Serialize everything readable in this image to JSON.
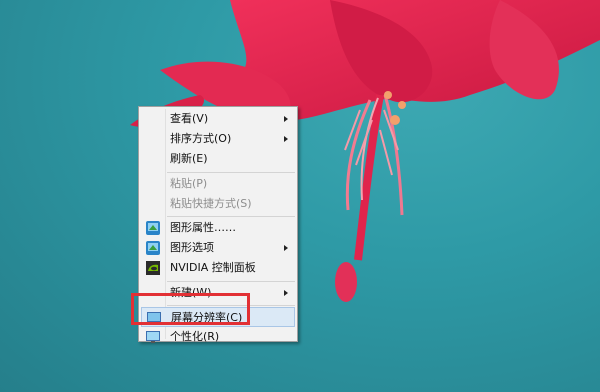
{
  "context_menu": {
    "items": [
      {
        "label": "查看(V)",
        "submenu": true,
        "enabled": true
      },
      {
        "label": "排序方式(O)",
        "submenu": true,
        "enabled": true
      },
      {
        "label": "刷新(E)",
        "submenu": false,
        "enabled": true
      },
      {
        "label": "粘贴(P)",
        "submenu": false,
        "enabled": false
      },
      {
        "label": "粘贴快捷方式(S)",
        "submenu": false,
        "enabled": false
      },
      {
        "label": "图形属性……",
        "submenu": false,
        "enabled": true,
        "icon": "intel-graphics-icon"
      },
      {
        "label": "图形选项",
        "submenu": true,
        "enabled": true,
        "icon": "intel-graphics-icon"
      },
      {
        "label": "NVIDIA 控制面板",
        "submenu": false,
        "enabled": true,
        "icon": "nvidia-icon"
      },
      {
        "label": "新建(W)",
        "submenu": true,
        "enabled": true
      },
      {
        "label": "屏幕分辨率(C)",
        "submenu": false,
        "enabled": true,
        "icon": "display-icon",
        "highlighted": true
      },
      {
        "label": "个性化(R)",
        "submenu": false,
        "enabled": true,
        "icon": "personalize-icon"
      }
    ]
  },
  "colors": {
    "highlight_border": "#e23034",
    "desktop_bg": "#2e9aa6",
    "flower": "#e0244c"
  }
}
